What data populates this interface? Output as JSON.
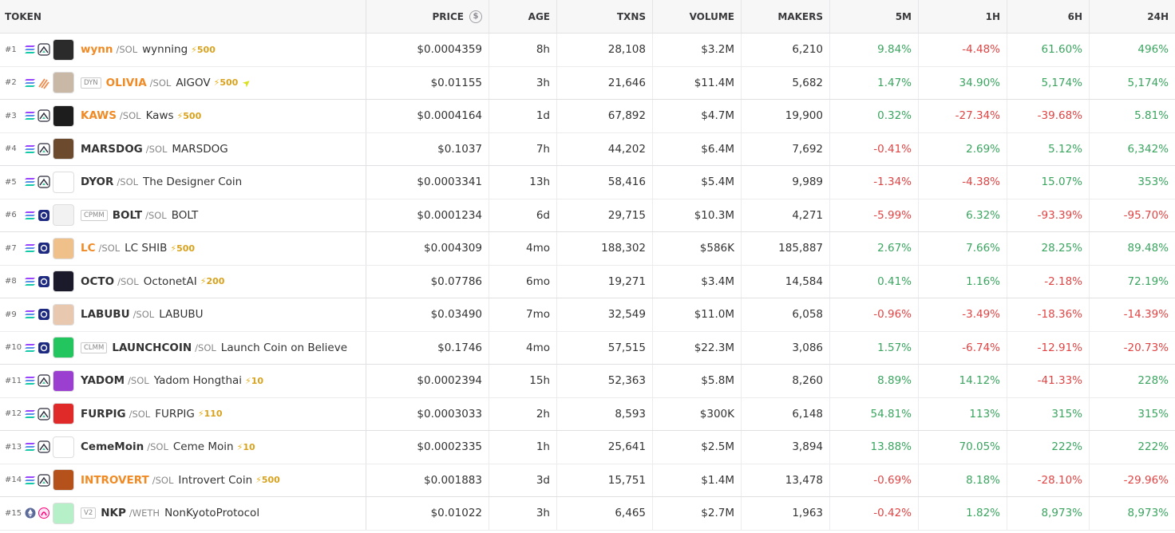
{
  "headers": {
    "token": "TOKEN",
    "price": "PRICE",
    "price_icon": "$",
    "age": "AGE",
    "txns": "TXNS",
    "volume": "VOLUME",
    "makers": "MAKERS",
    "m5": "5M",
    "h1": "1H",
    "h6": "6H",
    "h24": "24H"
  },
  "colors": {
    "positive": "#3ba560",
    "negative": "#e04545",
    "accent_orange": "#f08a24",
    "boost": "#d8a21e"
  },
  "rows": [
    {
      "rank": "#1",
      "chain": "solana-icon",
      "dex": "raydium-icon",
      "tag": "",
      "symbol": "wynn",
      "symbol_orange": true,
      "pair": "/SOL",
      "name": "wynning",
      "boost": "500",
      "price": "$0.0004359",
      "age": "8h",
      "txns": "28,108",
      "volume": "$3.2M",
      "makers": "6,210",
      "m5": "9.84%",
      "h1": "-4.48%",
      "h6": "61.60%",
      "h24": "496%",
      "avatar_color": "#2b2b2b"
    },
    {
      "rank": "#2",
      "chain": "solana-icon",
      "dex": "stripe-dex-icon",
      "tag": "DYN",
      "symbol": "OLIVIA",
      "symbol_orange": true,
      "pair": "/SOL",
      "name": "AIGOV",
      "boost": "500",
      "price": "$0.01155",
      "age": "3h",
      "txns": "21,646",
      "volume": "$11.4M",
      "makers": "5,682",
      "m5": "1.47%",
      "h1": "34.90%",
      "h6": "5,174%",
      "h24": "5,174%",
      "avatar_color": "#c9b8a5"
    },
    {
      "rank": "#3",
      "chain": "solana-icon",
      "dex": "raydium-icon",
      "tag": "",
      "symbol": "KAWS",
      "symbol_orange": true,
      "pair": "/SOL",
      "name": "Kaws",
      "boost": "500",
      "price": "$0.0004164",
      "age": "1d",
      "txns": "67,892",
      "volume": "$4.7M",
      "makers": "19,900",
      "m5": "0.32%",
      "h1": "-27.34%",
      "h6": "-39.68%",
      "h24": "5.81%",
      "avatar_color": "#1d1d1d"
    },
    {
      "rank": "#4",
      "chain": "solana-icon",
      "dex": "raydium-icon",
      "tag": "",
      "symbol": "MARSDOG",
      "symbol_orange": false,
      "pair": "/SOL",
      "name": "MARSDOG",
      "boost": "",
      "price": "$0.1037",
      "age": "7h",
      "txns": "44,202",
      "volume": "$6.4M",
      "makers": "7,692",
      "m5": "-0.41%",
      "h1": "2.69%",
      "h6": "5.12%",
      "h24": "6,342%",
      "avatar_color": "#6b4a2e"
    },
    {
      "rank": "#5",
      "chain": "solana-icon",
      "dex": "raydium-icon",
      "tag": "",
      "symbol": "DYOR",
      "symbol_orange": false,
      "pair": "/SOL",
      "name": "The Designer Coin",
      "boost": "",
      "price": "$0.0003341",
      "age": "13h",
      "txns": "58,416",
      "volume": "$5.4M",
      "makers": "9,989",
      "m5": "-1.34%",
      "h1": "-4.38%",
      "h6": "15.07%",
      "h24": "353%",
      "avatar_color": "#ffffff"
    },
    {
      "rank": "#6",
      "chain": "solana-icon",
      "dex": "meteora-icon",
      "tag": "CPMM",
      "symbol": "BOLT",
      "symbol_orange": false,
      "pair": "/SOL",
      "name": "BOLT",
      "boost": "",
      "price": "$0.0001234",
      "age": "6d",
      "txns": "29,715",
      "volume": "$10.3M",
      "makers": "4,271",
      "m5": "-5.99%",
      "h1": "6.32%",
      "h6": "-93.39%",
      "h24": "-95.70%",
      "avatar_color": "#f2f2f2"
    },
    {
      "rank": "#7",
      "chain": "solana-icon",
      "dex": "meteora-icon",
      "tag": "",
      "symbol": "LC",
      "symbol_orange": true,
      "pair": "/SOL",
      "name": "LC SHIB",
      "boost": "500",
      "price": "$0.004309",
      "age": "4mo",
      "txns": "188,302",
      "volume": "$586K",
      "makers": "185,887",
      "m5": "2.67%",
      "h1": "7.66%",
      "h6": "28.25%",
      "h24": "89.48%",
      "avatar_color": "#f0c08a"
    },
    {
      "rank": "#8",
      "chain": "solana-icon",
      "dex": "meteora-icon",
      "tag": "",
      "symbol": "OCTO",
      "symbol_orange": false,
      "pair": "/SOL",
      "name": "OctonetAI",
      "boost": "200",
      "price": "$0.07786",
      "age": "6mo",
      "txns": "19,271",
      "volume": "$3.4M",
      "makers": "14,584",
      "m5": "0.41%",
      "h1": "1.16%",
      "h6": "-2.18%",
      "h24": "72.19%",
      "avatar_color": "#1a1a2a"
    },
    {
      "rank": "#9",
      "chain": "solana-icon",
      "dex": "meteora-icon",
      "tag": "",
      "symbol": "LABUBU",
      "symbol_orange": false,
      "pair": "/SOL",
      "name": "LABUBU",
      "boost": "",
      "price": "$0.03490",
      "age": "7mo",
      "txns": "32,549",
      "volume": "$11.0M",
      "makers": "6,058",
      "m5": "-0.96%",
      "h1": "-3.49%",
      "h6": "-18.36%",
      "h24": "-14.39%",
      "avatar_color": "#e8c9b0"
    },
    {
      "rank": "#10",
      "chain": "solana-icon",
      "dex": "meteora-icon",
      "tag": "CLMM",
      "symbol": "LAUNCHCOIN",
      "symbol_orange": false,
      "pair": "/SOL",
      "name": "Launch Coin on Believe",
      "boost": "",
      "price": "$0.1746",
      "age": "4mo",
      "txns": "57,515",
      "volume": "$22.3M",
      "makers": "3,086",
      "m5": "1.57%",
      "h1": "-6.74%",
      "h6": "-12.91%",
      "h24": "-20.73%",
      "avatar_color": "#22c55e"
    },
    {
      "rank": "#11",
      "chain": "solana-icon",
      "dex": "raydium-icon",
      "tag": "",
      "symbol": "YADOM",
      "symbol_orange": false,
      "pair": "/SOL",
      "name": "Yadom Hongthai",
      "boost": "10",
      "price": "$0.0002394",
      "age": "15h",
      "txns": "52,363",
      "volume": "$5.8M",
      "makers": "8,260",
      "m5": "8.89%",
      "h1": "14.12%",
      "h6": "-41.33%",
      "h24": "228%",
      "avatar_color": "#9b3fd1"
    },
    {
      "rank": "#12",
      "chain": "solana-icon",
      "dex": "raydium-icon",
      "tag": "",
      "symbol": "FURPIG",
      "symbol_orange": false,
      "pair": "/SOL",
      "name": "FURPIG",
      "boost": "110",
      "price": "$0.0003033",
      "age": "2h",
      "txns": "8,593",
      "volume": "$300K",
      "makers": "6,148",
      "m5": "54.81%",
      "h1": "113%",
      "h6": "315%",
      "h24": "315%",
      "avatar_color": "#e02a2a"
    },
    {
      "rank": "#13",
      "chain": "solana-icon",
      "dex": "raydium-icon",
      "tag": "",
      "symbol": "CemeMoin",
      "symbol_orange": false,
      "pair": "/SOL",
      "name": "Ceme Moin",
      "boost": "10",
      "price": "$0.0002335",
      "age": "1h",
      "txns": "25,641",
      "volume": "$2.5M",
      "makers": "3,894",
      "m5": "13.88%",
      "h1": "70.05%",
      "h6": "222%",
      "h24": "222%",
      "avatar_color": "#ffffff"
    },
    {
      "rank": "#14",
      "chain": "solana-icon",
      "dex": "raydium-icon",
      "tag": "",
      "symbol": "INTROVERT",
      "symbol_orange": true,
      "pair": "/SOL",
      "name": "Introvert Coin",
      "boost": "500",
      "price": "$0.001883",
      "age": "3d",
      "txns": "15,751",
      "volume": "$1.4M",
      "makers": "13,478",
      "m5": "-0.69%",
      "h1": "8.18%",
      "h6": "-28.10%",
      "h24": "-29.96%",
      "avatar_color": "#b5521c"
    },
    {
      "rank": "#15",
      "chain": "ethereum-icon",
      "dex": "uniswap-icon",
      "tag": "V2",
      "symbol": "NKP",
      "symbol_orange": false,
      "pair": "/WETH",
      "name": "NonKyotoProtocol",
      "boost": "",
      "price": "$0.01022",
      "age": "3h",
      "txns": "6,465",
      "volume": "$2.7M",
      "makers": "1,963",
      "m5": "-0.42%",
      "h1": "1.82%",
      "h6": "8,973%",
      "h24": "8,973%",
      "avatar_color": "#b6f0c8"
    }
  ]
}
